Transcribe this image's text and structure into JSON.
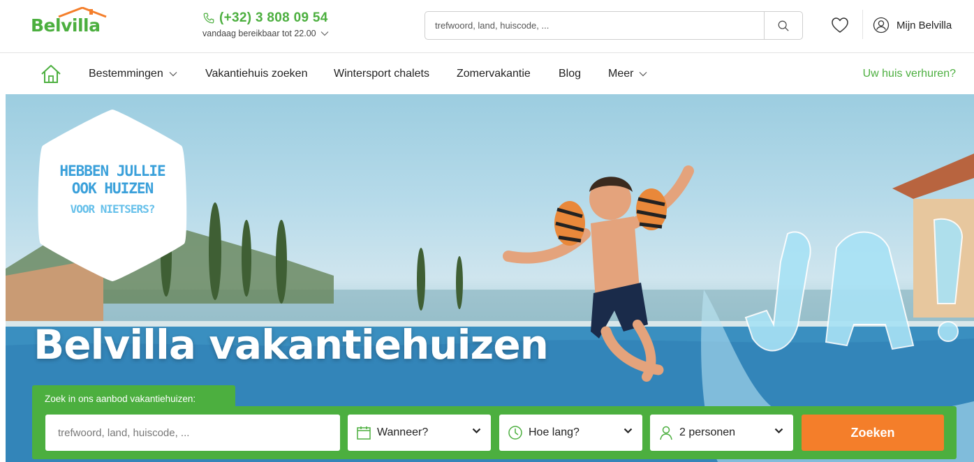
{
  "brand": {
    "logo_text": "Belvilla",
    "accent": "#4caf3f",
    "cta_color": "#f47e2a"
  },
  "header": {
    "phone": "(+32) 3 808 09 54",
    "availability": "vandaag bereikbaar tot 22.00",
    "search_placeholder": "trefwoord, land, huiscode, ...",
    "account_label": "Mijn Belvilla",
    "icons": [
      "phone-icon",
      "chevron-down-icon",
      "search-icon",
      "heart-icon",
      "user-icon"
    ]
  },
  "nav": {
    "items": [
      {
        "label": "Bestemmingen",
        "has_dropdown": true
      },
      {
        "label": "Vakantiehuis zoeken",
        "has_dropdown": false
      },
      {
        "label": "Wintersport chalets",
        "has_dropdown": false
      },
      {
        "label": "Zomervakantie",
        "has_dropdown": false
      },
      {
        "label": "Blog",
        "has_dropdown": false
      },
      {
        "label": "Meer",
        "has_dropdown": true
      }
    ],
    "right_link": "Uw huis verhuren?",
    "home_icon": "home-icon"
  },
  "hero": {
    "badge": {
      "line1": "HEBBEN JULLIE",
      "line2": "OOK HUIZEN",
      "line3": "VOOR NIETSERS?"
    },
    "title": "Belvilla vakantiehuizen"
  },
  "search_widget": {
    "tab_label": "Zoek in ons aanbod vakantiehuizen:",
    "keyword_placeholder": "trefwoord, land, huiscode, ...",
    "when_label": "Wanneer?",
    "duration_label": "Hoe lang?",
    "guests_label": "2 personen",
    "submit_label": "Zoeken",
    "icons": [
      "calendar-icon",
      "clock-icon",
      "person-icon",
      "chevron-down-icon"
    ]
  }
}
